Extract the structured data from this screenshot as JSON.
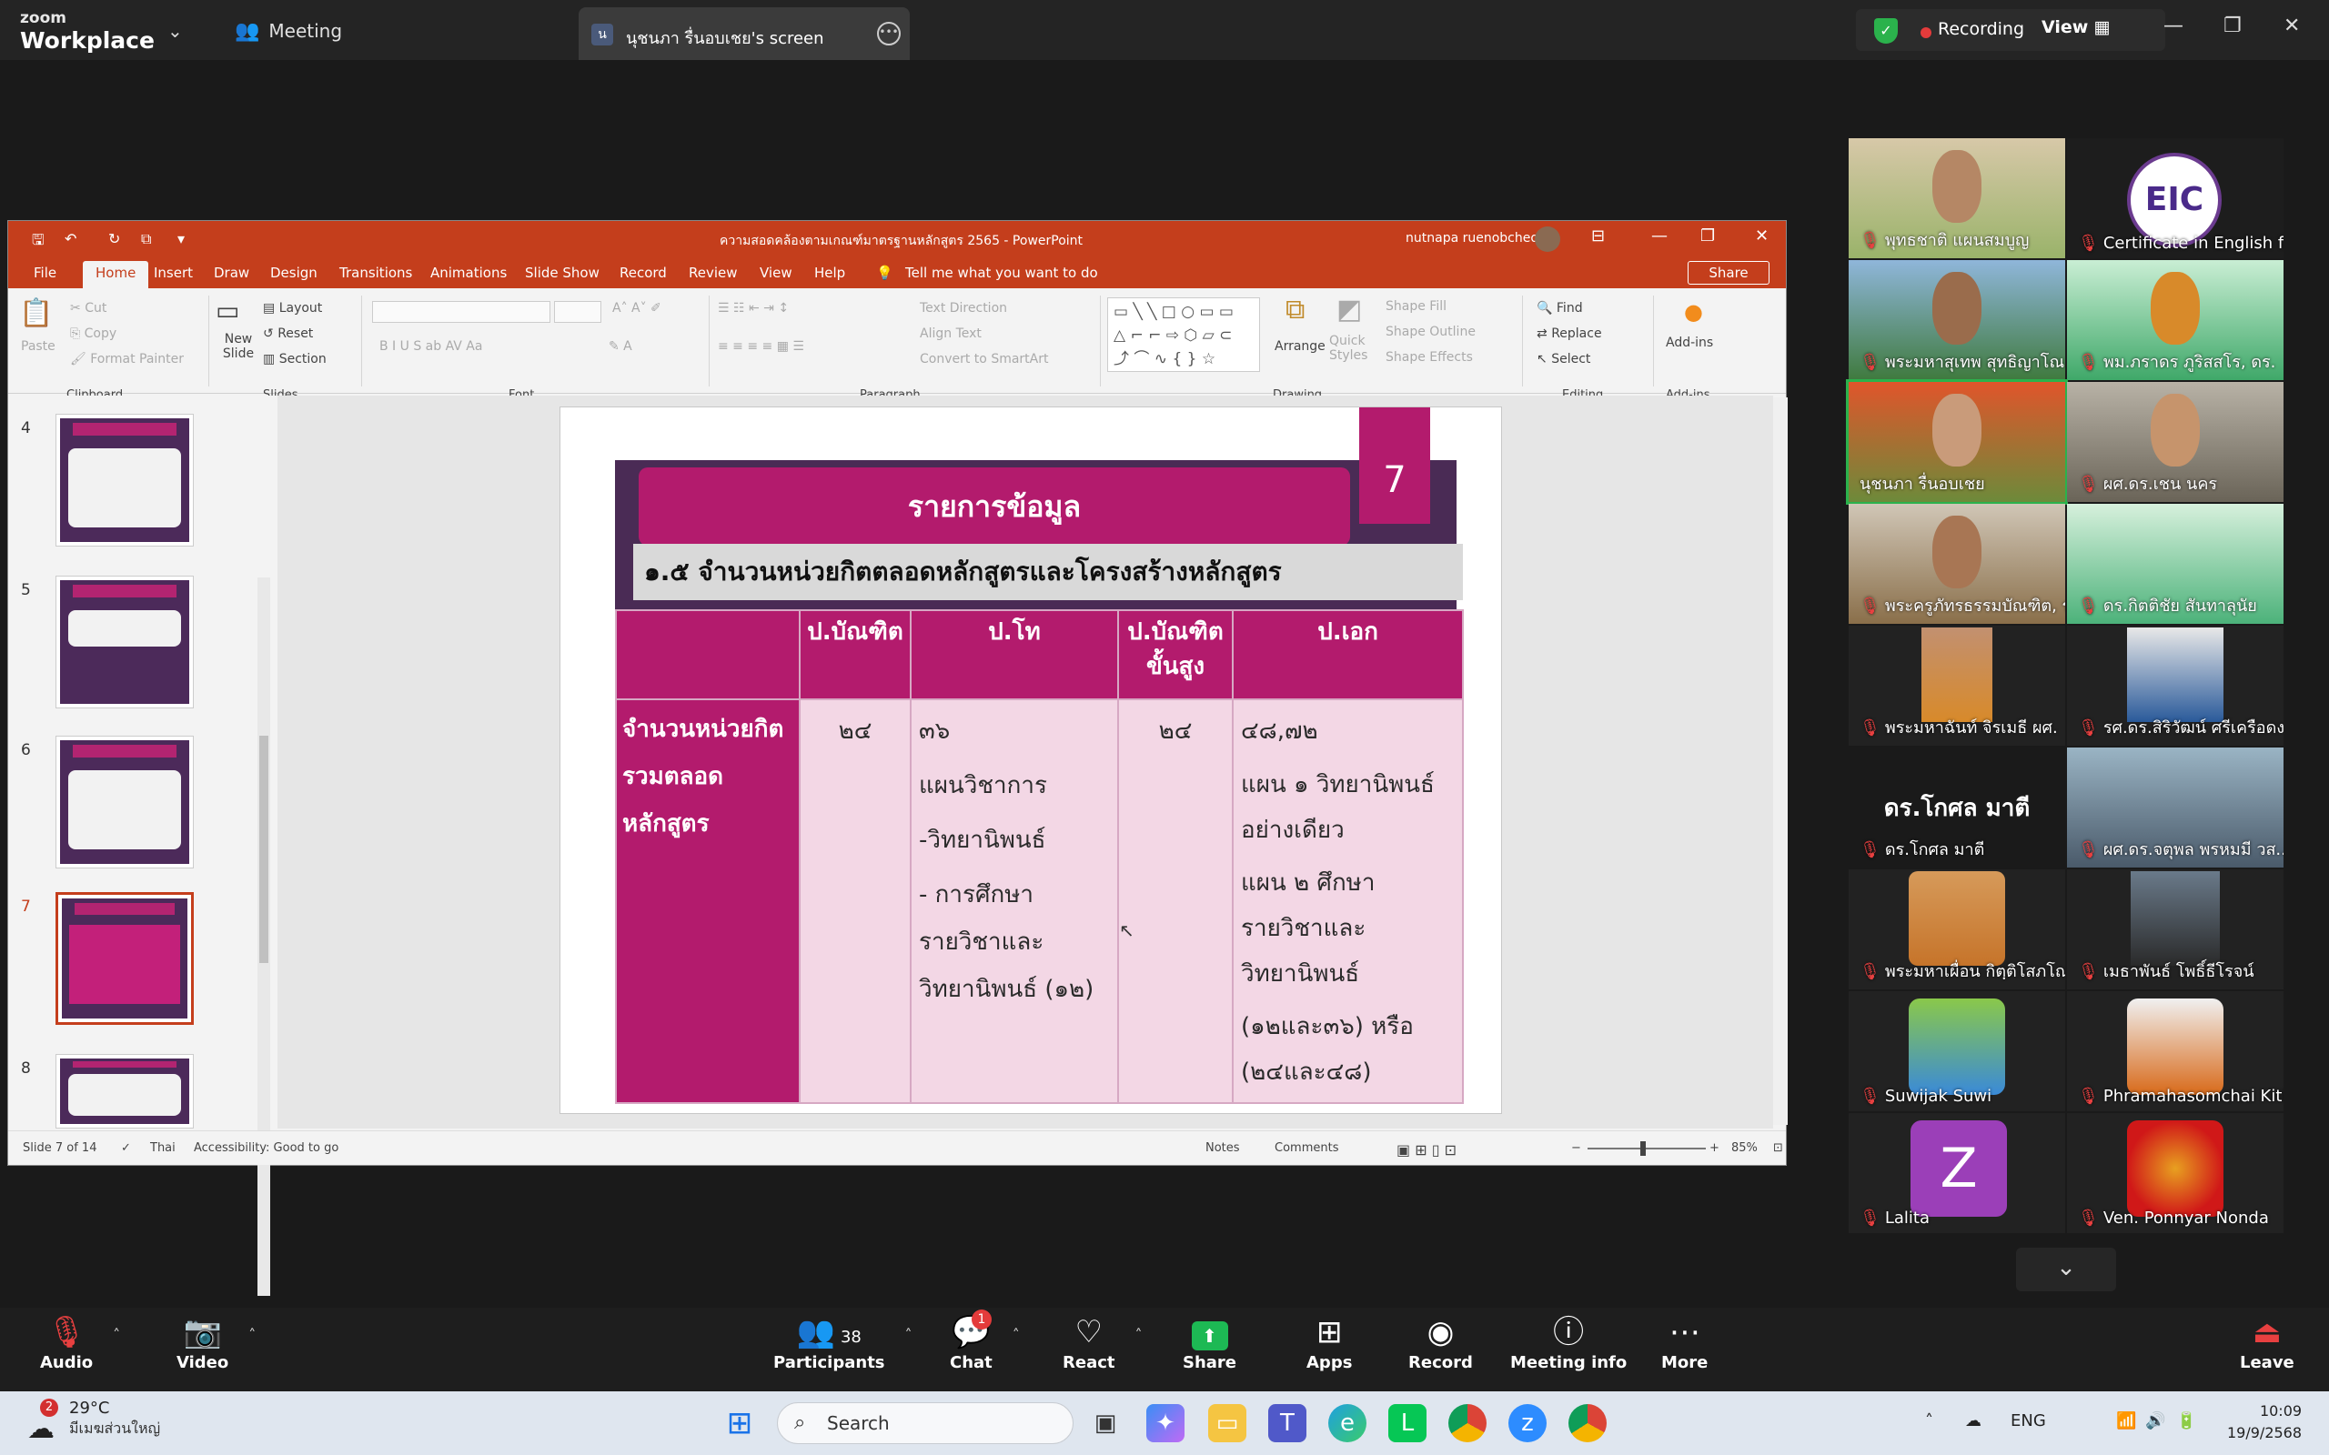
{
  "zoom": {
    "logo_top": "zoom",
    "logo_bottom": "Workplace",
    "meeting_label": "Meeting",
    "tab_title": "นุชนภา  รื่นอบเชย's screen",
    "tab_initial": "น",
    "recording_label": "Recording",
    "view_label": "View"
  },
  "ppt": {
    "title": "ความสอดคล้องตามเกณฑ์มาตรฐานหลักสูตร 2565  -  PowerPoint",
    "user": "nutnapa ruenobcheoy",
    "menu": [
      "File",
      "Home",
      "Insert",
      "Draw",
      "Design",
      "Transitions",
      "Animations",
      "Slide Show",
      "Record",
      "Review",
      "View",
      "Help"
    ],
    "tell_me": "Tell me what you want to do",
    "share": "Share",
    "ribbon": {
      "paste": "Paste",
      "cut": "Cut",
      "copy": "Copy",
      "format_painter": "Format Painter",
      "clipboard": "Clipboard",
      "new_slide": "New Slide",
      "layout": "Layout",
      "reset": "Reset",
      "section": "Section",
      "slides": "Slides",
      "font": "Font",
      "text_direction": "Text Direction",
      "align_text": "Align Text",
      "convert_smartart": "Convert to SmartArt",
      "paragraph": "Paragraph",
      "arrange": "Arrange",
      "quick_styles": "Quick Styles",
      "shape_fill": "Shape Fill",
      "shape_outline": "Shape Outline",
      "shape_effects": "Shape Effects",
      "drawing": "Drawing",
      "find": "Find",
      "replace": "Replace",
      "select": "Select",
      "editing": "Editing",
      "addins": "Add-ins",
      "addins_group": "Add-ins"
    },
    "thumb_numbers": [
      "4",
      "5",
      "6",
      "7",
      "8"
    ],
    "slide": {
      "number": "7",
      "title": "รายการข้อมูล",
      "subtitle": "๑.๕ จำนวนหน่วยกิตตลอดหลักสูตรและโครงสร้างหลักสูตร",
      "headers": [
        "",
        "ป.บัณฑิต",
        "ป.โท",
        "ป.บัณฑิต ขั้นสูง",
        "ป.เอก"
      ],
      "row_label": "จำนวนหน่วยกิตรวมตลอดหลักสูตร",
      "col1": "๒๔",
      "col2_value": "๓๖",
      "col2_line1": "แผนวิชาการ",
      "col2_line2": "-วิทยานิพนธ์",
      "col2_line3": "- การศึกษารายวิชาและวิทยานิพนธ์ (๑๒)",
      "col3": "๒๔",
      "col4_value": "๔๘,๗๒",
      "col4_line1": "แผน ๑ วิทยานิพนธ์อย่างเดียว",
      "col4_line2": "แผน ๒ ศึกษารายวิชาและวิทยานิพนธ์",
      "col4_line3": "(๑๒และ๓๖) หรือ (๒๔และ๔๘)"
    },
    "status": {
      "slide_of": "Slide 7 of 14",
      "lang": "Thai",
      "accessibility": "Accessibility: Good to go",
      "notes": "Notes",
      "comments": "Comments",
      "zoom": "85%"
    }
  },
  "participants": [
    "พุทธชาติ แผนสมบูญ",
    "Certificate in English f...",
    "พระมหาสุเทพ สุทธิญาโณ",
    "พม.ภราดร ภูริสสโร, ดร.",
    "นุชนภา  รื่นอบเชย",
    "ผศ.ดร.เชน นคร",
    "พระครูภัทรธรรมบัณฑิต, ร...",
    "ดร.กิตติชัย สันทาลุนัย",
    "พระมหาฉันท์ จิรเมธี ผศ.",
    "รศ.ดร.สิริวัฒน์ ศรีเครือดง",
    "ดร.โกศล มาตี",
    "ผศ.ดร.จตุพล พรหมมี วส...",
    "พระมหาเผื่อน กิตฺติโสภโณ,...",
    "เมธาพันธ์ โพธิ์ธีโรจน์",
    "Suwijak Suwi",
    "Phramahasomchai Kiti...",
    "Lalita",
    "Ven. Ponnyar Nonda"
  ],
  "tile_text": {
    "eic": "EIC",
    "big_name": "ดร.โกศล มาตี",
    "initial": "Z"
  },
  "controls": {
    "audio": "Audio",
    "video": "Video",
    "participants": "Participants",
    "participants_count": "38",
    "chat": "Chat",
    "chat_badge": "1",
    "react": "React",
    "share": "Share",
    "apps": "Apps",
    "record": "Record",
    "meeting_info": "Meeting info",
    "more": "More",
    "leave": "Leave"
  },
  "taskbar": {
    "weather_badge": "2",
    "temp": "29°C",
    "weather_desc": "มีเมฆส่วนใหญ่",
    "search": "Search",
    "lang": "ENG",
    "time": "10:09",
    "date": "19/9/2568"
  }
}
